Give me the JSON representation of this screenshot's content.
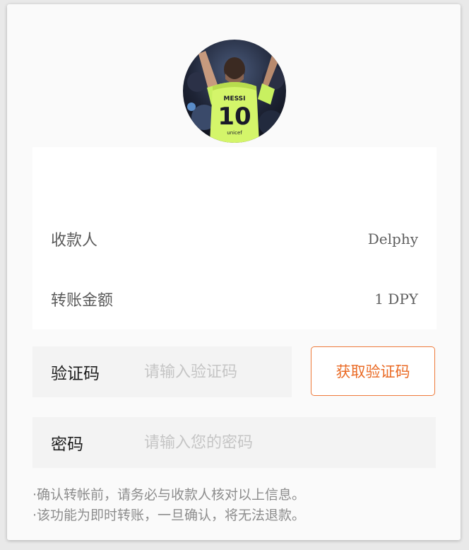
{
  "avatar": {
    "jersey_name": "MESSI",
    "jersey_number": "10",
    "sponsor": "unicef"
  },
  "transfer_info": {
    "payee_label": "收款人",
    "payee_value": "Delphy",
    "amount_label": "转账金额",
    "amount_value": "1 DPY"
  },
  "verification": {
    "label": "验证码",
    "placeholder": "请输入验证码",
    "value": "",
    "get_code_label": "获取验证码"
  },
  "password": {
    "label": "密码",
    "placeholder": "请输入您的密码",
    "value": ""
  },
  "notes": [
    "·确认转帐前，请务必与收款人核对以上信息。",
    "·该功能为即时转账，一旦确认，将无法退款。"
  ],
  "colors": {
    "accent": "#ea6a24",
    "field_bg": "#f3f3f3",
    "card_bg": "#ffffff",
    "page_bg": "#fafafa"
  }
}
